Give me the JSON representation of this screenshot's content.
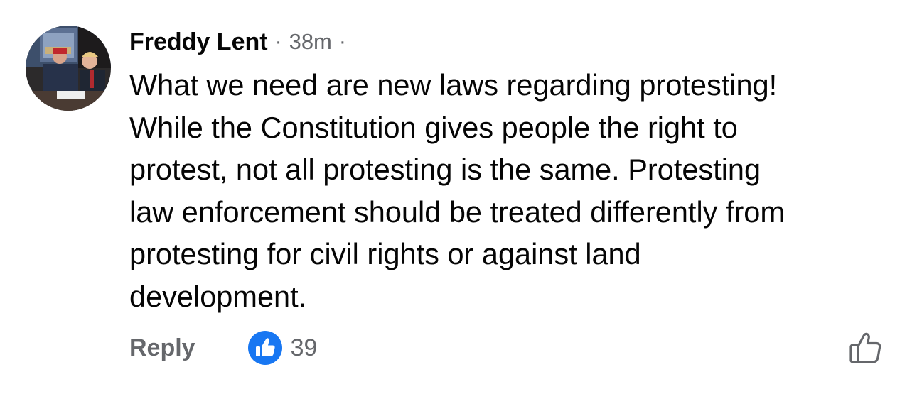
{
  "comment": {
    "author": "Freddy Lent",
    "separator": "·",
    "timestamp": "38m",
    "text_lines": [
      "What we need are new laws regarding protesting!",
      "While the Constitution gives people the right to",
      "protest, not all protesting is the same. Protesting",
      "law enforcement should be treated differently from",
      "protesting for civil rights or against land",
      "development."
    ],
    "reply_label": "Reply",
    "reaction_count": "39",
    "reaction_icon": "thumbs-up-icon",
    "like_button_icon": "thumbs-up-outline-icon"
  },
  "colors": {
    "text_primary": "#050505",
    "text_secondary": "#65676b",
    "reaction_blue": "#1877f2"
  }
}
